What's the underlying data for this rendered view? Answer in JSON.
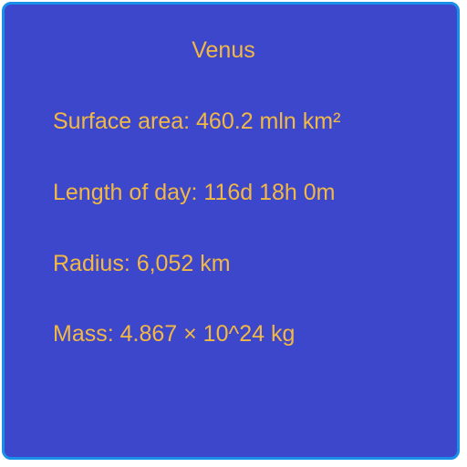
{
  "card": {
    "title": "Venus",
    "facts": [
      "Surface area: 460.2 mln km²",
      "Length of day: 116d 18h 0m",
      "Radius: 6,052 km",
      "Mass: 4.867 × 10^24 kg"
    ]
  },
  "colors": {
    "background": "#3d47cc",
    "border": "#1a8fe8",
    "text": "#f2b844"
  }
}
